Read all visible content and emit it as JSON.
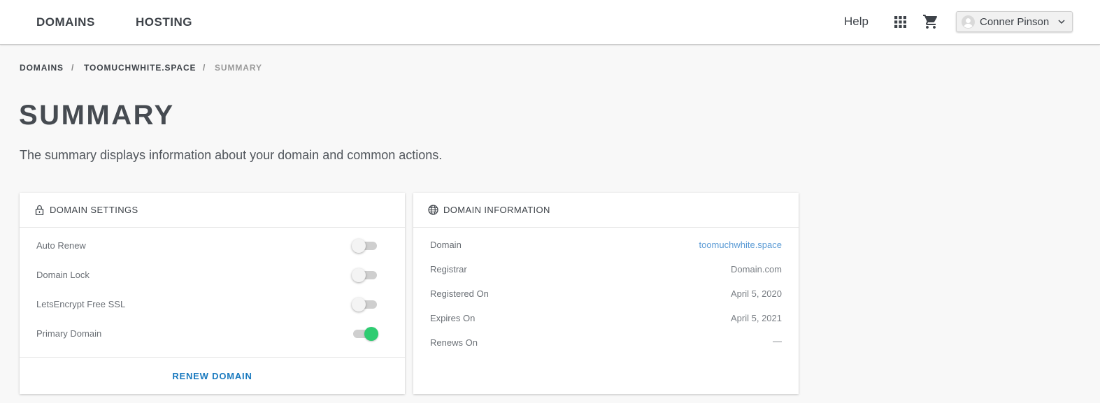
{
  "nav": {
    "domains": "DOMAINS",
    "hosting": "HOSTING",
    "help": "Help",
    "user_name": "Conner Pinson"
  },
  "breadcrumb": {
    "items": [
      "DOMAINS",
      "TOOMUCHWHITE.SPACE",
      "SUMMARY"
    ],
    "separator": "/"
  },
  "page": {
    "title": "SUMMARY",
    "description": "The summary displays information about your domain and common actions."
  },
  "settings_card": {
    "title": "DOMAIN SETTINGS",
    "icon": "lock-icon",
    "rows": [
      {
        "label": "Auto Renew",
        "enabled": false
      },
      {
        "label": "Domain Lock",
        "enabled": false
      },
      {
        "label": "LetsEncrypt Free SSL",
        "enabled": false
      },
      {
        "label": "Primary Domain",
        "enabled": true
      }
    ],
    "renew_label": "RENEW DOMAIN"
  },
  "info_card": {
    "title": "DOMAIN INFORMATION",
    "icon": "globe-icon",
    "rows": [
      {
        "label": "Domain",
        "value": "toomuchwhite.space"
      },
      {
        "label": "Registrar",
        "value": "Domain.com"
      },
      {
        "label": "Registered On",
        "value": "April 5, 2020"
      },
      {
        "label": "Expires On",
        "value": "April 5, 2021"
      },
      {
        "label": "Renews On",
        "value": "—"
      }
    ]
  },
  "colors": {
    "toggle_on": "#2ecc71",
    "link": "#5b9bd5",
    "action": "#1a7abf"
  }
}
